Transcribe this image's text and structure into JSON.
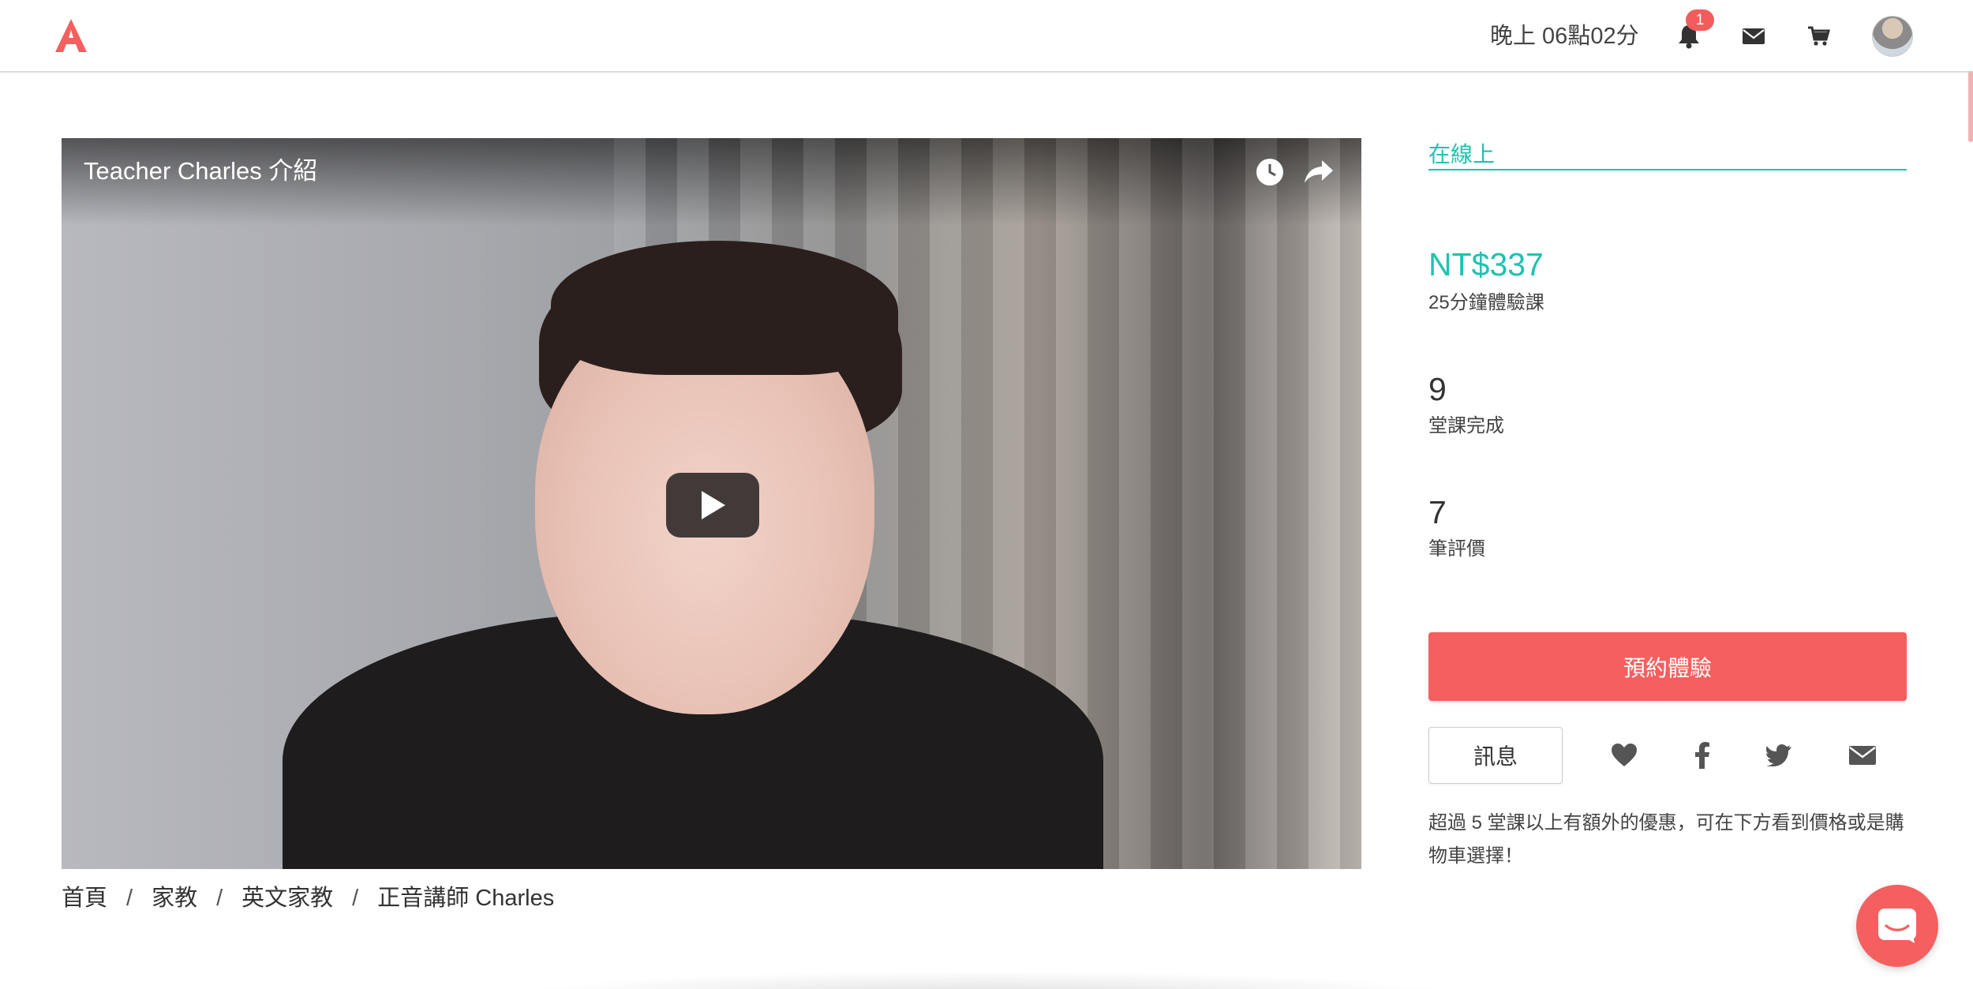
{
  "header": {
    "logo_letter": "A",
    "time_text": "晚上 06點02分",
    "notification_count": "1",
    "icons": [
      "bell-icon",
      "envelope-icon",
      "cart-icon",
      "avatar"
    ]
  },
  "video": {
    "title": "Teacher Charles 介紹",
    "icons": [
      "clock-icon",
      "share-icon",
      "play-icon"
    ]
  },
  "breadcrumb": {
    "items": [
      "首頁",
      "家教",
      "英文家教",
      "正音講師 Charles"
    ],
    "separator": "/"
  },
  "panel": {
    "tab_label": "在線上",
    "price": "NT$337",
    "price_desc": "25分鐘體驗課",
    "stats": [
      {
        "value": "9",
        "label": "堂課完成"
      },
      {
        "value": "7",
        "label": "筆評價"
      }
    ],
    "book_button": "預約體驗",
    "message_button": "訊息",
    "share_icons": [
      "heart-icon",
      "facebook-icon",
      "twitter-icon",
      "mail-icon"
    ],
    "note": "超過 5 堂課以上有額外的優惠，可在下方看到價格或是購物車選擇！"
  },
  "colors": {
    "accent": "#20c2b1",
    "brand": "#f65f5f"
  }
}
